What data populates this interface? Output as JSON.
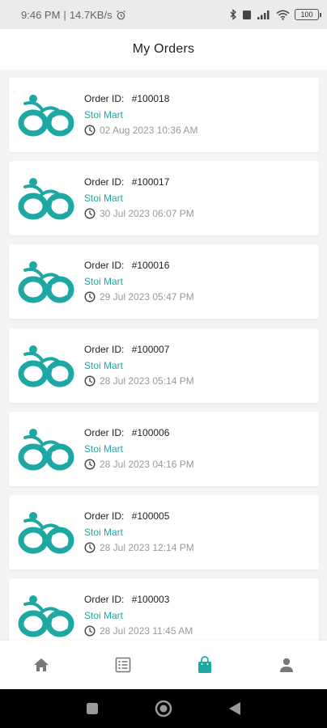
{
  "status_bar": {
    "time": "9:46 PM",
    "network_speed": "14.7KB/s",
    "battery": "100"
  },
  "header": {
    "title": "My Orders"
  },
  "colors": {
    "accent": "#1ea8a4",
    "muted": "#9a9a9a",
    "icon_gray": "#777777"
  },
  "orders": [
    {
      "id_label": "Order ID:",
      "id": "#100018",
      "store": "Stoi Mart",
      "datetime": "02 Aug 2023  10:36 AM"
    },
    {
      "id_label": "Order ID:",
      "id": "#100017",
      "store": "Stoi Mart",
      "datetime": "30 Jul 2023  06:07 PM"
    },
    {
      "id_label": "Order ID:",
      "id": "#100016",
      "store": "Stoi Mart",
      "datetime": "29 Jul 2023  05:47 PM"
    },
    {
      "id_label": "Order ID:",
      "id": "#100007",
      "store": "Stoi Mart",
      "datetime": "28 Jul 2023  05:14 PM"
    },
    {
      "id_label": "Order ID:",
      "id": "#100006",
      "store": "Stoi Mart",
      "datetime": "28 Jul 2023  04:16 PM"
    },
    {
      "id_label": "Order ID:",
      "id": "#100005",
      "store": "Stoi Mart",
      "datetime": "28 Jul 2023  12:14 PM"
    },
    {
      "id_label": "Order ID:",
      "id": "#100003",
      "store": "Stoi Mart",
      "datetime": "28 Jul 2023  11:45 AM"
    }
  ],
  "bottom_nav": [
    {
      "name": "home-icon",
      "active": false
    },
    {
      "name": "list-icon",
      "active": false
    },
    {
      "name": "shopping-bag-icon",
      "active": true
    },
    {
      "name": "user-icon",
      "active": false
    }
  ]
}
